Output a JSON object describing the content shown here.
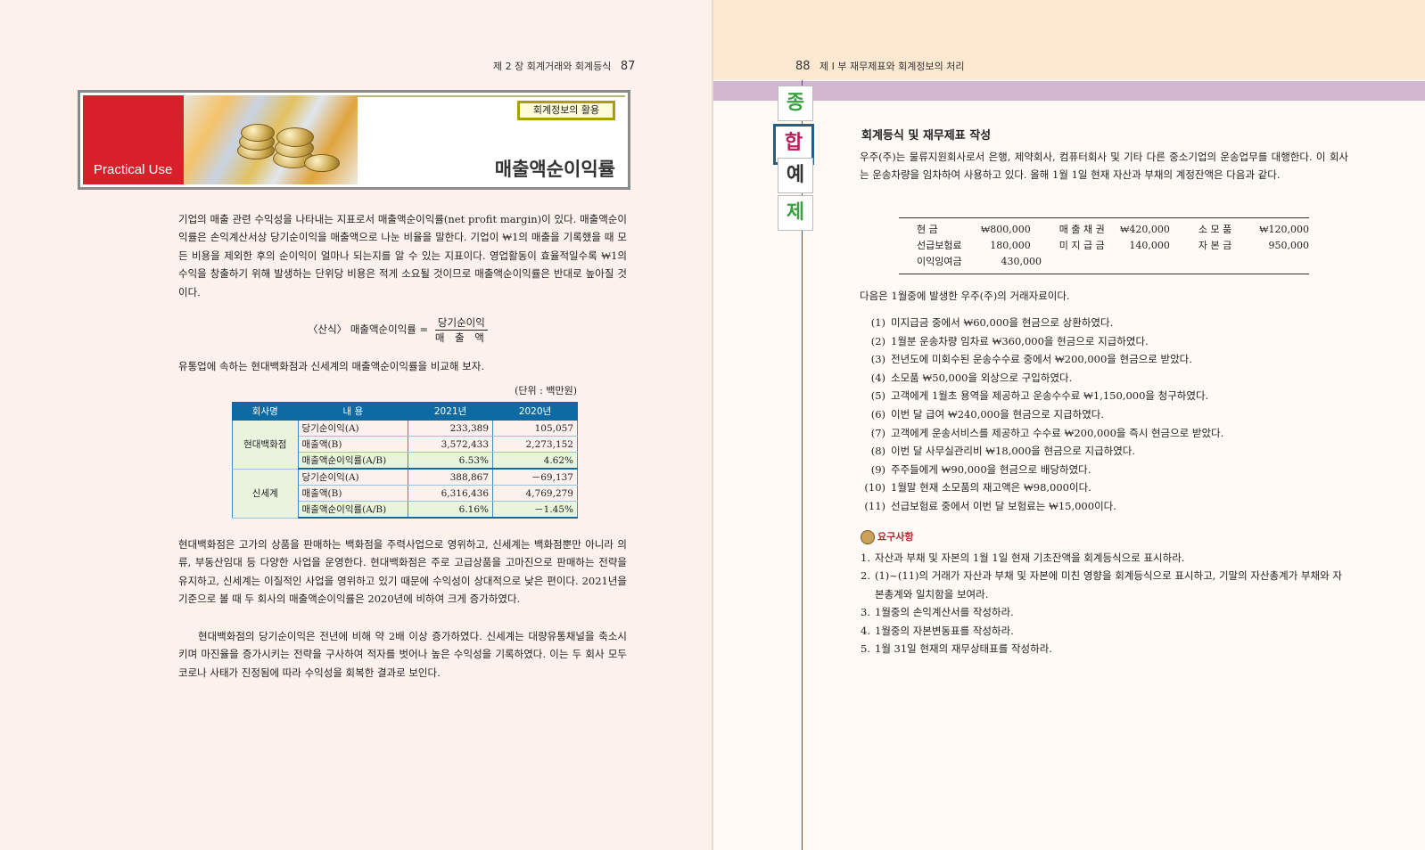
{
  "left": {
    "running_head": "제 2 장  회계거래와 회계등식",
    "page_number": "87",
    "banner": {
      "practical": "Practical Use",
      "tag": "회계정보의 활용",
      "title": "매출액순이익률"
    },
    "para1": "기업의 매출 관련 수익성을 나타내는 지표로서 매출액순이익률(net profit margin)이 있다. 매출액순이익률은 손익계산서상 당기순이익을 매출액으로 나눈 비율을 말한다. 기업이 ₩1의 매출을 기록했을 때 모든 비용을 제외한 후의 순이익이 얼마나 되는지를 알 수 있는 지표이다. 영업활동이 효율적일수록 ₩1의 수익을 창출하기 위해 발생하는 단위당 비용은 적게 소요될 것이므로 매출액순이익률은 반대로 높아질 것이다.",
    "formula": {
      "prefix": "〈산식〉  매출액순이익률 =",
      "numerator": "당기순이익",
      "denominator": "매 출 액"
    },
    "para2": "유통업에 속하는 현대백화점과 신세계의 매출액순이익률을 비교해 보자.",
    "unit": "(단위 : 백만원)",
    "table": {
      "headers": [
        "회사명",
        "내  용",
        "2021년",
        "2020년"
      ],
      "companies": [
        {
          "name": "현대백화점",
          "rows": [
            {
              "label": "당기순이익(A)",
              "y2021": "233,389",
              "y2020": "105,057"
            },
            {
              "label": "매출액(B)",
              "y2021": "3,572,433",
              "y2020": "2,273,152"
            },
            {
              "label": "매출액순이익률(A/B)",
              "y2021": "6.53%",
              "y2020": "4.62%"
            }
          ]
        },
        {
          "name": "신세계",
          "rows": [
            {
              "label": "당기순이익(A)",
              "y2021": "388,867",
              "y2020": "－69,137"
            },
            {
              "label": "매출액(B)",
              "y2021": "6,316,436",
              "y2020": "4,769,279"
            },
            {
              "label": "매출액순이익률(A/B)",
              "y2021": "6.16%",
              "y2020": "－1.45%"
            }
          ]
        }
      ]
    },
    "para3": "현대백화점은 고가의 상품을 판매하는 백화점을 주력사업으로 영위하고, 신세계는 백화점뿐만 아니라 의류, 부동산임대 등 다양한 사업을 운영한다. 현대백화점은 주로 고급상품을 고마진으로 판매하는 전략을 유지하고, 신세계는 이질적인 사업을 영위하고 있기 때문에 수익성이 상대적으로 낮은 편이다. 2021년을 기준으로 볼 때 두 회사의 매출액순이익률은 2020년에 비하여 크게 증가하였다.",
    "para4": "현대백화점의 당기순이익은 전년에 비해 약 2배 이상 증가하였다. 신세계는 대량유통채널을 축소시키며 마진율을 증가시키는 전략을 구사하여 적자를 벗어나 높은 수익성을 기록하였다. 이는 두 회사 모두 코로나 사태가 진정됨에 따라 수익성을 회복한 결과로 보인다."
  },
  "right": {
    "page_number": "88",
    "running_head": "제 I 부  재무제표와 회계정보의 처리",
    "badges": [
      "종",
      "합",
      "예",
      "제"
    ],
    "title": "회계등식 및 재무제표 작성",
    "intro": "우주(주)는 물류지원회사로서 은행, 제약회사, 컴퓨터회사 및 기타 다른 중소기업의 운송업무를 대행한다. 이 회사는 운송차량을 임차하여 사용하고 있다. 올해 1월 1일 현재 자산과 부채의 계정잔액은 다음과 같다.",
    "balances": [
      [
        {
          "label": "현          금",
          "value": "₩800,000"
        },
        {
          "label": "매 출 채 권",
          "value": "₩420,000"
        },
        {
          "label": "소   모   품",
          "value": "₩120,000"
        }
      ],
      [
        {
          "label": "선급보험료",
          "value": "180,000"
        },
        {
          "label": "미 지 급 금",
          "value": "140,000"
        },
        {
          "label": "자   본   금",
          "value": "950,000"
        }
      ],
      [
        {
          "label": "이익잉여금",
          "value": "430,000"
        }
      ]
    ],
    "transactions_intro": "다음은 1월중에 발생한 우주(주)의 거래자료이다.",
    "transactions": [
      {
        "key": "(1)",
        "text": "미지급금 중에서  ₩60,000을 현금으로 상환하였다."
      },
      {
        "key": "(2)",
        "text": "1월분 운송차량 임차료  ₩360,000을 현금으로 지급하였다."
      },
      {
        "key": "(3)",
        "text": "전년도에 미회수된 운송수수료 중에서  ₩200,000을 현금으로 받았다."
      },
      {
        "key": "(4)",
        "text": "소모품  ₩50,000을 외상으로 구입하였다."
      },
      {
        "key": "(5)",
        "text": "고객에게 1월초 용역을 제공하고 운송수수료  ₩1,150,000을 청구하였다."
      },
      {
        "key": "(6)",
        "text": "이번 달 급여  ₩240,000을 현금으로 지급하였다."
      },
      {
        "key": "(7)",
        "text": "고객에게 운송서비스를 제공하고 수수료  ₩200,000을 즉시 현금으로 받았다."
      },
      {
        "key": "(8)",
        "text": "이번 달 사무실관리비  ₩18,000을 현금으로 지급하였다."
      },
      {
        "key": "(9)",
        "text": "주주들에게  ₩90,000을 현금으로 배당하였다."
      },
      {
        "key": "(10)",
        "text": "1월말 현재 소모품의 재고액은  ₩98,000이다."
      },
      {
        "key": "(11)",
        "text": "선급보험료 중에서 이번 달 보험료는  ₩15,000이다."
      }
    ],
    "requirements_heading": "요구사항",
    "requirements": [
      {
        "key": "1.",
        "text": "자산과 부채 및 자본의 1월 1일 현재 기초잔액을 회계등식으로 표시하라."
      },
      {
        "key": "2.",
        "text": "(1)~(11)의 거래가 자산과 부채 및 자본에 미친 영향을 회계등식으로 표시하고, 기말의 자산총계가 부채와 자본총계와 일치함을 보여라."
      },
      {
        "key": "3.",
        "text": "1월중의 손익계산서를 작성하라."
      },
      {
        "key": "4.",
        "text": "1월중의 자본변동표를 작성하라."
      },
      {
        "key": "5.",
        "text": "1월 31일 현재의 재무상태표를 작성하라."
      }
    ]
  }
}
